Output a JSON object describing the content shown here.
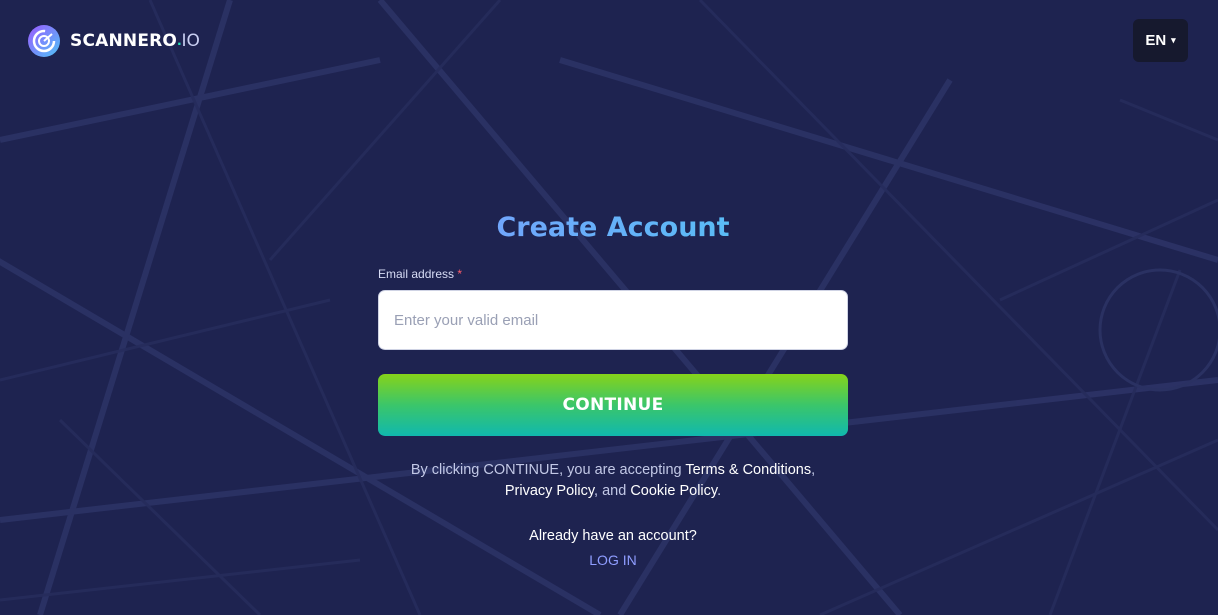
{
  "header": {
    "brand_name": "SCANNERO",
    "brand_dot": ".",
    "brand_tld": "IO",
    "language": "EN",
    "language_caret": "▾"
  },
  "form": {
    "title": "Create Account",
    "email_label": "Email address",
    "required_mark": "*",
    "email_value": "",
    "email_placeholder": "Enter your valid email",
    "continue_label": "CONTINUE"
  },
  "terms": {
    "prefix": "By clicking CONTINUE, you are accepting ",
    "terms_link": "Terms & Conditions",
    "comma": ",",
    "privacy_link": "Privacy Policy",
    "and_text": ", and ",
    "cookie_link": "Cookie Policy",
    "suffix": "."
  },
  "footer": {
    "already_text": "Already have an account?",
    "login_label": "LOG IN"
  },
  "colors": {
    "background": "#1e2350",
    "title_gradient_start": "#7c9bff",
    "title_gradient_end": "#4fc7f2",
    "button_gradient_top": "#86d31a",
    "button_gradient_bottom": "#10b8ae",
    "login_link": "#8f9dff"
  },
  "icons": {
    "brand_logo": "scannero-logo-icon"
  }
}
